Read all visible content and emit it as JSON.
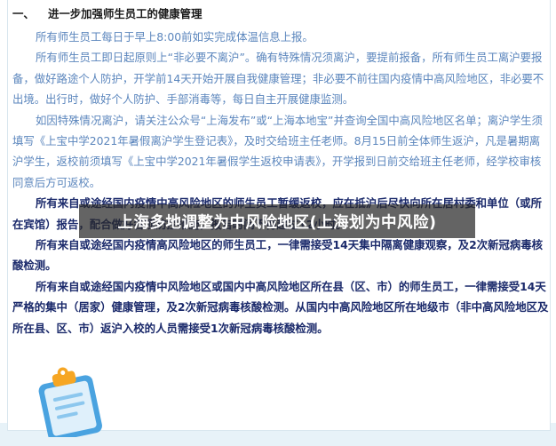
{
  "document": {
    "heading_number": "一、",
    "heading_title": "进一步加强师生员工的健康管理",
    "paragraphs": [
      {
        "style": "faded",
        "text": "所有师生员工每日于早上8:00前如实完成体温信息上报。"
      },
      {
        "style": "faded",
        "text": "所有师生员工即日起原则上“非必要不离沪”。确有特殊情况须离沪，要提前报备，所有师生员工离沪要报备，做好路途个人防护，开学前14天开始开展自我健康管理；非必要不前往国内疫情中高风险地区，非必要不出境。出行时，做好个人防护、手部消毒等，每日自主开展健康监测。"
      },
      {
        "style": "faded",
        "text": "如因特殊情况离沪，请关注公众号“上海发布”或“上海本地宝”并查询全国中高风险地区名单；离沪学生须填写《上宝中学2021年暑假离沪学生登记表》，及时交给班主任老师。8月15日前全体师生返沪，凡是暑期离沪学生，返校前须填写《上宝中学2021年暑假学生返校申请表》，开学报到日前交给班主任老师，经学校审核同意后方可返校。"
      },
      {
        "style": "strong",
        "text": "所有来自或途经国内疫情中高风险地区的师生员工暂缓返校，应在抵沪后尽快向所在居村委和单位（或所在宾馆）报告，配合做好各项防控措施，报告时间不得超过12小时。"
      },
      {
        "style": "strong",
        "text": "所有来自或途经国内疫情高风险地区的师生员工，一律需接受14天集中隔离健康观察，及2次新冠病毒核酸检测。"
      },
      {
        "style": "strong",
        "text": "所有来自或途经国内疫情中风险地区或国内中高风险地区所在县（区、市）的师生员工，一律需接受14天严格的集中（居家）健康管理，及2次新冠病毒核酸检测。从国内中高风险地区所在地级市（非中高风险地区及所在县、区、市）返沪入校的人员需接受1次新冠病毒核酸检测。"
      }
    ]
  },
  "overlay_title": "上海多地调整为中风险地区(上海划为中风险)",
  "icons": {
    "illustration": "clipboard-icon"
  },
  "colors": {
    "body_text": "#1b2a6b",
    "faded_text": "#5b86bd",
    "overlay_bg": "#282828",
    "clipboard_blue": "#4aa3e0",
    "clip_orange": "#f6a623"
  }
}
